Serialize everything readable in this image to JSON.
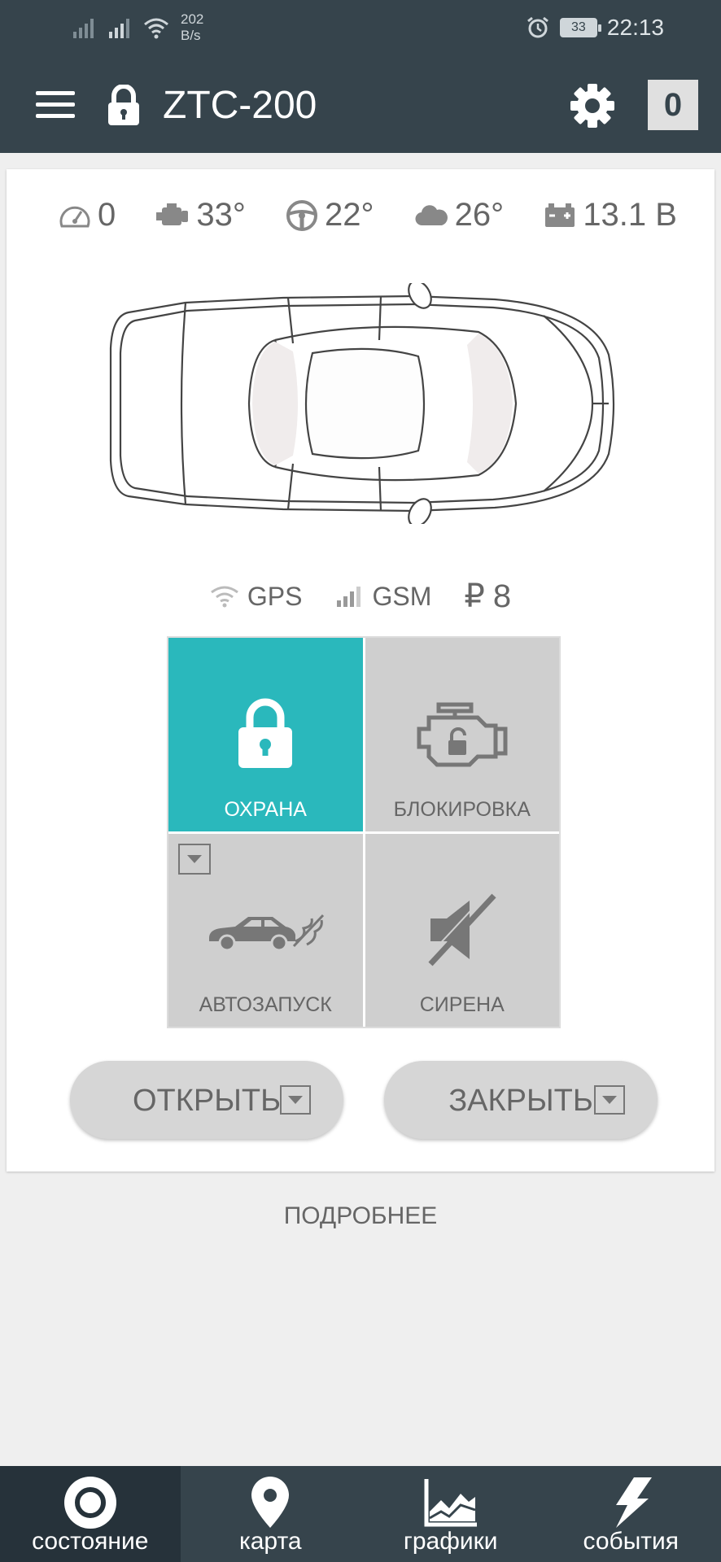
{
  "status_bar": {
    "speed_value": "202",
    "speed_unit": "B/s",
    "battery": "33",
    "time": "22:13"
  },
  "app_bar": {
    "title": "ZTC-200",
    "count": "0"
  },
  "sensors": [
    {
      "icon": "speedometer-icon",
      "value": "0"
    },
    {
      "icon": "engine-icon",
      "value": "33°"
    },
    {
      "icon": "steering-wheel-icon",
      "value": "22°"
    },
    {
      "icon": "cloud-icon",
      "value": "26°"
    },
    {
      "icon": "car-battery-icon",
      "value": "13.1 В"
    }
  ],
  "signals": {
    "gps": "GPS",
    "gsm": "GSM",
    "currency_symbol": "₽",
    "balance": "8"
  },
  "tiles": {
    "guard": "ОХРАНА",
    "block": "БЛОКИРОВКА",
    "autostart": "АВТОЗАПУСК",
    "siren": "СИРЕНА"
  },
  "actions": {
    "open": "ОТКРЫТЬ",
    "close": "ЗАКРЫТЬ"
  },
  "details_link": "ПОДРОБНЕЕ",
  "bottom_nav": [
    {
      "label": "состояние",
      "icon": "status-ring-icon",
      "active": true
    },
    {
      "label": "карта",
      "icon": "map-pin-icon",
      "active": false
    },
    {
      "label": "графики",
      "icon": "chart-icon",
      "active": false
    },
    {
      "label": "события",
      "icon": "lightning-icon",
      "active": false
    }
  ],
  "colors": {
    "bar": "#36444c",
    "accent": "#2ab8bc",
    "tile": "#cfcfcf"
  }
}
